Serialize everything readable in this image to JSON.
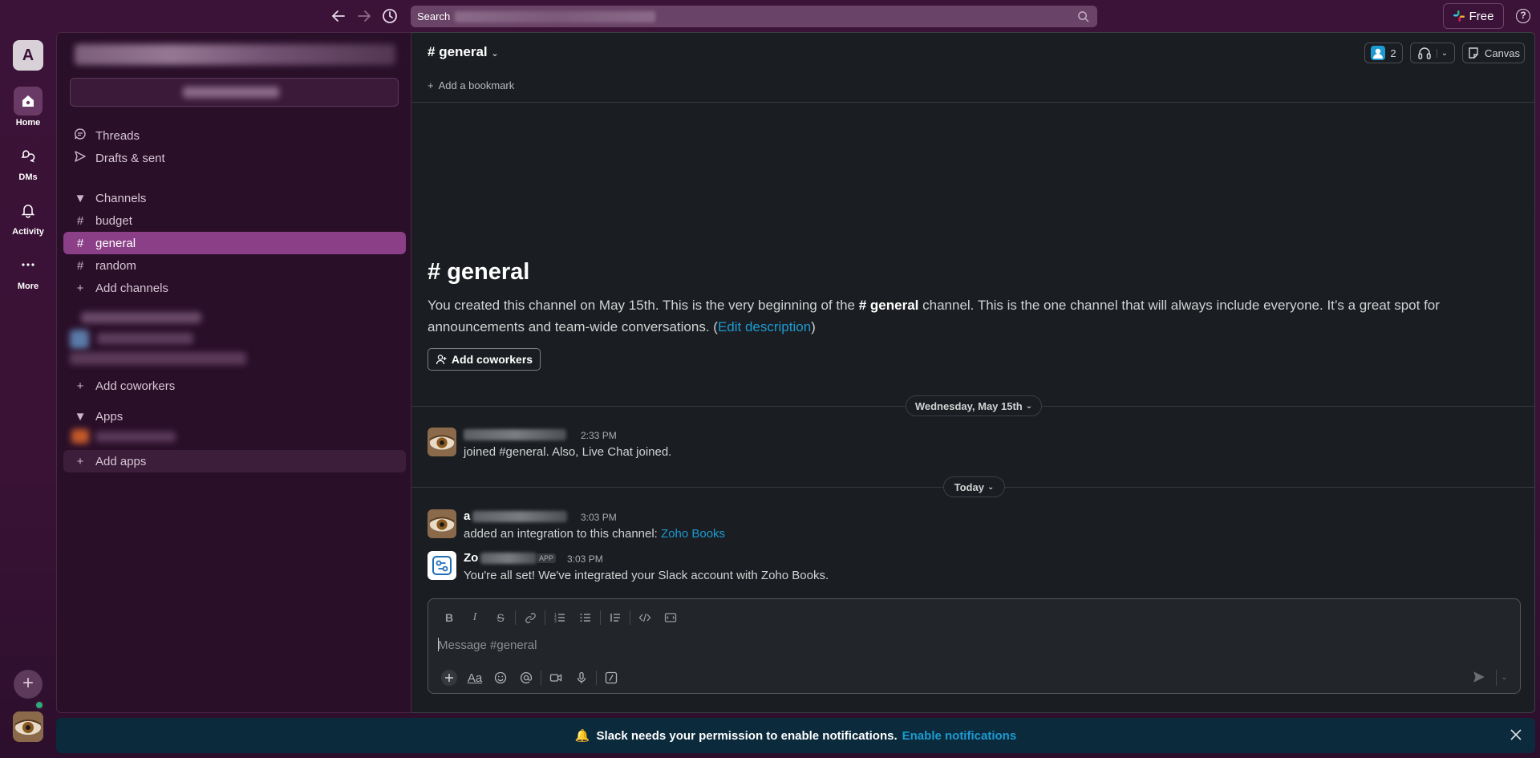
{
  "topbar": {
    "search_label": "Search",
    "free_label": "Free",
    "help_label": "?"
  },
  "rail": {
    "workspace_initial": "A",
    "items": [
      {
        "label": "Home"
      },
      {
        "label": "DMs"
      },
      {
        "label": "Activity"
      },
      {
        "label": "More"
      }
    ]
  },
  "sidebar": {
    "threads": "Threads",
    "drafts": "Drafts & sent",
    "channels_header": "Channels",
    "channels": [
      "budget",
      "general",
      "random"
    ],
    "add_channels": "Add channels",
    "add_coworkers": "Add coworkers",
    "apps_header": "Apps",
    "add_apps": "Add apps"
  },
  "channel": {
    "name": "general",
    "members_count": "2",
    "canvas_label": "Canvas",
    "add_bookmark": "Add a bookmark",
    "intro_title": "general",
    "intro_text_1": "You created this channel on May 15th. This is the very beginning of the ",
    "intro_channel": "general",
    "intro_text_2": " channel. This is the one channel that will always include everyone. It’s a great spot for announcements and team-wide conversations. (",
    "edit_description": "Edit description",
    "intro_text_3": ")",
    "add_coworkers_btn": "Add coworkers"
  },
  "messages": {
    "date_1": "Wednesday, May 15th",
    "date_2": "Today",
    "m1_time": "2:33 PM",
    "m1_text": "joined #general. Also, Live Chat joined.",
    "m2_name_prefix": "a",
    "m2_time": "3:03 PM",
    "m2_text": "added an integration to this channel: ",
    "m2_link": "Zoho Books",
    "m3_name_prefix": "Zo",
    "m3_badge": "APP",
    "m3_time": "3:03 PM",
    "m3_text": "You're all set! We've integrated your Slack account with Zoho Books."
  },
  "composer": {
    "placeholder": "Message #general"
  },
  "banner": {
    "emoji": "🔔",
    "text": "Slack needs your permission to enable notifications.",
    "link": "Enable notifications"
  },
  "colors": {
    "aubergine": "#3b1338",
    "sidebar_active": "#8b3f87",
    "main_bg": "#1a1d21",
    "link": "#1d9bd1",
    "presence": "#2bac76"
  }
}
